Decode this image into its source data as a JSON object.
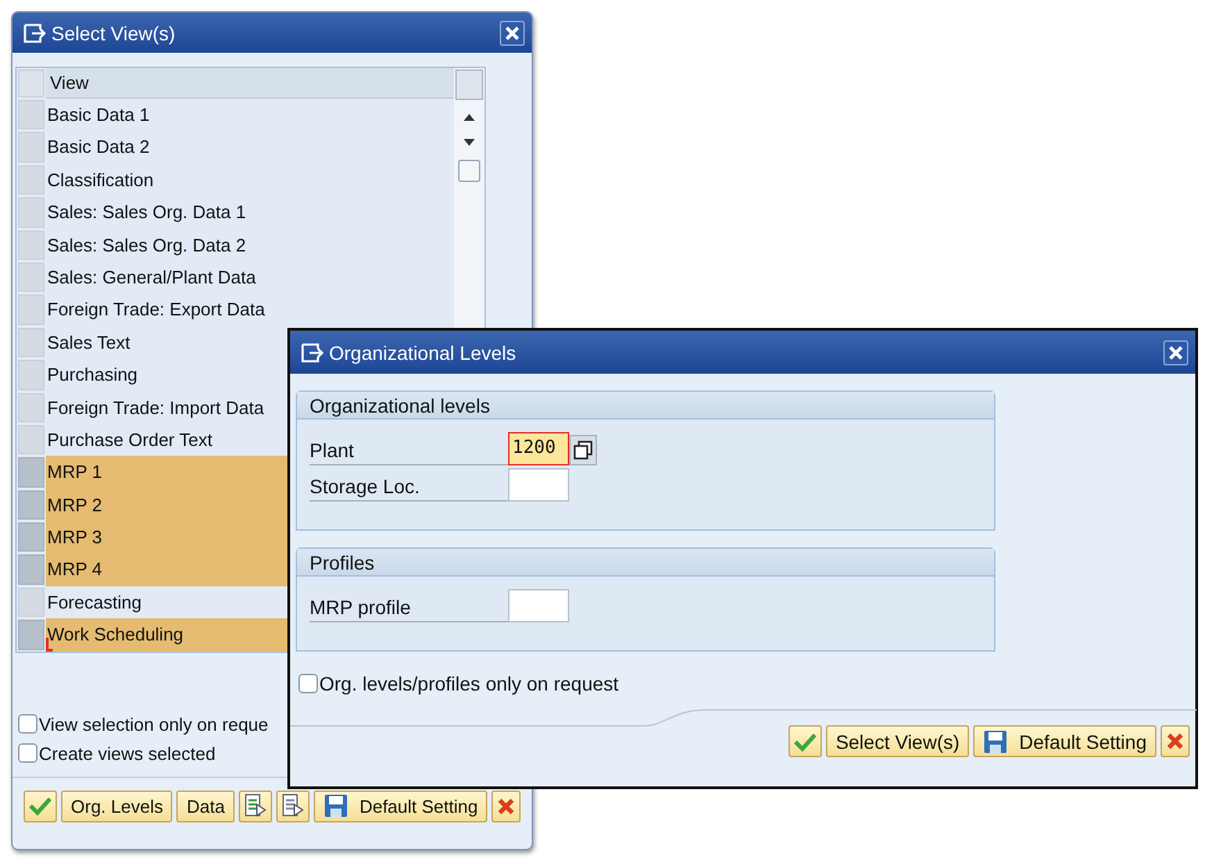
{
  "select_views_dialog": {
    "title": "Select View(s)",
    "table": {
      "column": "View",
      "rows": [
        {
          "label": "Basic Data 1",
          "selected": false,
          "focused": false
        },
        {
          "label": "Basic Data 2",
          "selected": false,
          "focused": false
        },
        {
          "label": "Classification",
          "selected": false,
          "focused": false
        },
        {
          "label": "Sales: Sales Org. Data 1",
          "selected": false,
          "focused": false
        },
        {
          "label": "Sales: Sales Org. Data 2",
          "selected": false,
          "focused": false
        },
        {
          "label": "Sales: General/Plant Data",
          "selected": false,
          "focused": false
        },
        {
          "label": "Foreign Trade: Export Data",
          "selected": false,
          "focused": false
        },
        {
          "label": "Sales Text",
          "selected": false,
          "focused": false
        },
        {
          "label": "Purchasing",
          "selected": false,
          "focused": false
        },
        {
          "label": "Foreign Trade: Import Data",
          "selected": false,
          "focused": false
        },
        {
          "label": "Purchase Order Text",
          "selected": false,
          "focused": false
        },
        {
          "label": "MRP 1",
          "selected": true,
          "focused": false
        },
        {
          "label": "MRP 2",
          "selected": true,
          "focused": false
        },
        {
          "label": "MRP 3",
          "selected": true,
          "focused": false
        },
        {
          "label": "MRP 4",
          "selected": true,
          "focused": false
        },
        {
          "label": "Forecasting",
          "selected": false,
          "focused": false
        },
        {
          "label": "Work Scheduling",
          "selected": true,
          "focused": true
        }
      ]
    },
    "checkboxes": [
      {
        "label": "View selection only on reque",
        "checked": false
      },
      {
        "label": "Create views selected",
        "checked": false
      }
    ],
    "buttons": [
      {
        "label": "Org. Levels"
      },
      {
        "label": "Data"
      }
    ],
    "default_button": {
      "label": "Default Setting"
    }
  },
  "org_levels_dialog": {
    "title": "Organizational Levels",
    "groups": [
      {
        "title": "Organizational levels",
        "fields": [
          {
            "label": "Plant",
            "value": "1200",
            "focused": true,
            "help": true
          },
          {
            "label": "Storage Loc.",
            "focused": false,
            "help": false
          }
        ]
      },
      {
        "title": "Profiles",
        "fields": [
          {
            "label": "MRP profile",
            "focused": false,
            "help": false
          }
        ]
      }
    ],
    "checkbox": {
      "label": "Org. levels/profiles only on request",
      "checked": false
    },
    "select_button": {
      "label": "Select View(s)"
    },
    "default_button": {
      "label": "Default Setting"
    }
  }
}
